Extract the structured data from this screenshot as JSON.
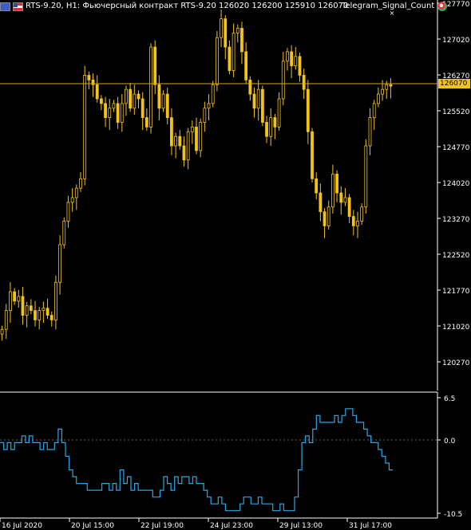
{
  "header": {
    "symbol_info": "RTS-9.20, H1:  Фьючерсный контракт RTS-9.20  126020 126200 125910 126070",
    "indicator_label": "Telegram_Signal_Count"
  },
  "main_chart": {
    "price_ticks": [
      "127770",
      "127020",
      "126270",
      "125520",
      "124770",
      "124020",
      "123270",
      "122520",
      "121770",
      "121020",
      "120270"
    ],
    "current_price": "126070",
    "colors": {
      "candle": "#f2c318",
      "price_line": "#d9a918",
      "axis": "#ffffff",
      "background": "#000000"
    }
  },
  "indicator": {
    "ticks": [
      "6.5",
      "0.0",
      "-10.5"
    ],
    "line_color": "#2aa8e6"
  },
  "time_axis": {
    "labels": [
      "16 Jul 2020",
      "20 Jul 15:00",
      "22 Jul 19:00",
      "24 Jul 23:00",
      "29 Jul 13:00",
      "31 Jul 17:00"
    ]
  },
  "chart_data": [
    {
      "type": "candlestick",
      "approx_close_path": [
        120900,
        121300,
        121700,
        121500,
        121600,
        121200,
        121400,
        121300,
        121100,
        121300,
        121350,
        121200,
        121100,
        121900,
        122700,
        123200,
        123600,
        123700,
        123900,
        124100,
        126300,
        126200,
        126100,
        125800,
        125700,
        125400,
        125600,
        125700,
        125300,
        125700,
        126000,
        125600,
        125900,
        125800,
        125400,
        125200,
        126900,
        126100,
        125600,
        125900,
        125400,
        124800,
        125000,
        124800,
        124500,
        125100,
        125200,
        124700,
        125300,
        125600,
        125700,
        126100,
        127100,
        127500,
        126900,
        126400,
        127200,
        127300,
        126800,
        126200,
        125900,
        125600,
        126000,
        125300,
        125000,
        125400,
        125200,
        125800,
        126600,
        126800,
        126500,
        126700,
        126300,
        126000,
        125100,
        124100,
        123800,
        123400,
        123100,
        123500,
        124200,
        123800,
        123600,
        123700,
        123300,
        123100,
        123200,
        123500,
        124800,
        125400,
        125700,
        125900,
        126000,
        126100,
        126070
      ],
      "y_range": [
        119600,
        127900
      ]
    },
    {
      "type": "line",
      "x_labels": [
        "16 Jul 2020",
        "20 Jul 15:00",
        "22 Jul 19:00",
        "24 Jul 23:00",
        "29 Jul 13:00",
        "31 Jul 17:00"
      ],
      "values": [
        0,
        -1,
        0,
        -1,
        0,
        0,
        1,
        0,
        1,
        0,
        0,
        -1,
        0,
        -1,
        -1,
        0,
        2,
        0,
        -2,
        -4,
        -5,
        -6,
        -6,
        -6,
        -7,
        -7,
        -7,
        -7,
        -6,
        -6,
        -7,
        -6,
        -7,
        -4,
        -6,
        -5,
        -7,
        -6,
        -7,
        -7,
        -7,
        -7,
        -8,
        -8,
        -7,
        -5,
        -6,
        -7,
        -5,
        -6,
        -5,
        -5,
        -6,
        -5,
        -6,
        -6,
        -7,
        -8,
        -9,
        -9,
        -8,
        -9,
        -10,
        -10,
        -10,
        -10,
        -9,
        -8,
        -8,
        -9,
        -9,
        -8,
        -9,
        -9,
        -9,
        -10,
        -10,
        -9,
        -10,
        -10,
        -10,
        -8,
        -4,
        0,
        1,
        0,
        2,
        4,
        3,
        3,
        3,
        3,
        4,
        3,
        4,
        5,
        5,
        4,
        3,
        3,
        2,
        1,
        0,
        0,
        -1,
        -2,
        -3,
        -4
      ],
      "y_range": [
        -10.5,
        6.5
      ]
    }
  ]
}
